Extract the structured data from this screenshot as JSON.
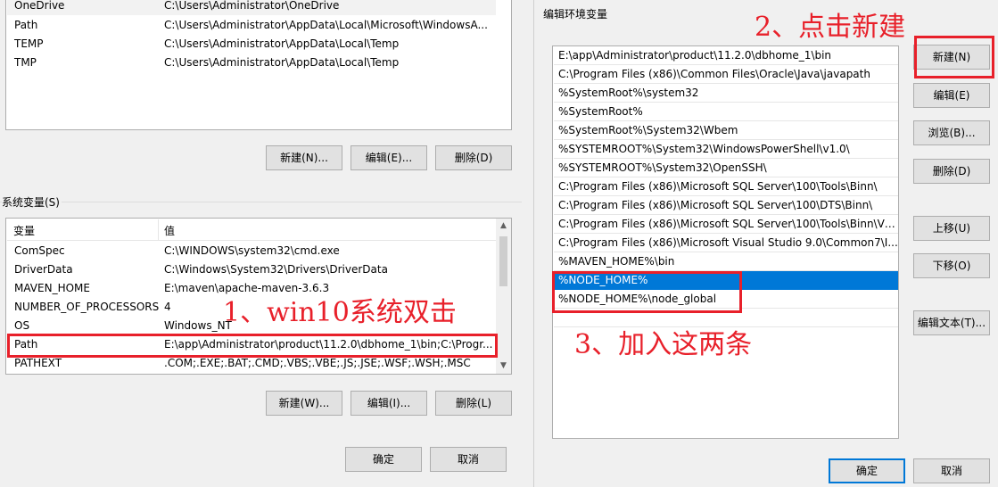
{
  "user_vars": {
    "rows": [
      {
        "name": "OneDrive",
        "value": "C:\\Users\\Administrator\\OneDrive"
      },
      {
        "name": "Path",
        "value": "C:\\Users\\Administrator\\AppData\\Local\\Microsoft\\WindowsA..."
      },
      {
        "name": "TEMP",
        "value": "C:\\Users\\Administrator\\AppData\\Local\\Temp"
      },
      {
        "name": "TMP",
        "value": "C:\\Users\\Administrator\\AppData\\Local\\Temp"
      }
    ],
    "buttons": {
      "new": "新建(N)...",
      "edit": "编辑(E)...",
      "delete": "删除(D)"
    }
  },
  "sys_vars": {
    "label": "系统变量(S)",
    "header": {
      "name": "变量",
      "value": "值"
    },
    "rows": [
      {
        "name": "ComSpec",
        "value": "C:\\WINDOWS\\system32\\cmd.exe"
      },
      {
        "name": "DriverData",
        "value": "C:\\Windows\\System32\\Drivers\\DriverData"
      },
      {
        "name": "MAVEN_HOME",
        "value": "E:\\maven\\apache-maven-3.6.3"
      },
      {
        "name": "NUMBER_OF_PROCESSORS",
        "value": "4"
      },
      {
        "name": "OS",
        "value": "Windows_NT"
      },
      {
        "name": "Path",
        "value": "E:\\app\\Administrator\\product\\11.2.0\\dbhome_1\\bin;C:\\Progr..."
      },
      {
        "name": "PATHEXT",
        "value": ".COM;.EXE;.BAT;.CMD;.VBS;.VBE;.JS;.JSE;.WSF;.WSH;.MSC"
      }
    ],
    "buttons": {
      "new": "新建(W)...",
      "edit": "编辑(I)...",
      "delete": "删除(L)"
    },
    "scroll_up": "▲",
    "scroll_down": "▼"
  },
  "left_footer": {
    "ok": "确定",
    "cancel": "取消"
  },
  "right_dialog": {
    "title": "编辑环境变量",
    "paths": [
      "E:\\app\\Administrator\\product\\11.2.0\\dbhome_1\\bin",
      "C:\\Program Files (x86)\\Common Files\\Oracle\\Java\\javapath",
      "%SystemRoot%\\system32",
      "%SystemRoot%",
      "%SystemRoot%\\System32\\Wbem",
      "%SYSTEMROOT%\\System32\\WindowsPowerShell\\v1.0\\",
      "%SYSTEMROOT%\\System32\\OpenSSH\\",
      "C:\\Program Files (x86)\\Microsoft SQL Server\\100\\Tools\\Binn\\",
      "C:\\Program Files (x86)\\Microsoft SQL Server\\100\\DTS\\Binn\\",
      "C:\\Program Files (x86)\\Microsoft SQL Server\\100\\Tools\\Binn\\VS...",
      "C:\\Program Files (x86)\\Microsoft Visual Studio 9.0\\Common7\\I...",
      "%MAVEN_HOME%\\bin",
      "%NODE_HOME%",
      "%NODE_HOME%\\node_global"
    ],
    "buttons": {
      "new": "新建(N)",
      "edit": "编辑(E)",
      "browse": "浏览(B)...",
      "delete": "删除(D)",
      "move_up": "上移(U)",
      "move_down": "下移(O)",
      "edit_text": "编辑文本(T)...",
      "ok": "确定",
      "cancel": "取消"
    }
  },
  "annotations": {
    "step1": "1、win10系统双击",
    "step2": "2、点击新建",
    "step3": "3、加入这两条"
  },
  "colors": {
    "highlight": "#e8202a",
    "selection": "#0078d7"
  }
}
